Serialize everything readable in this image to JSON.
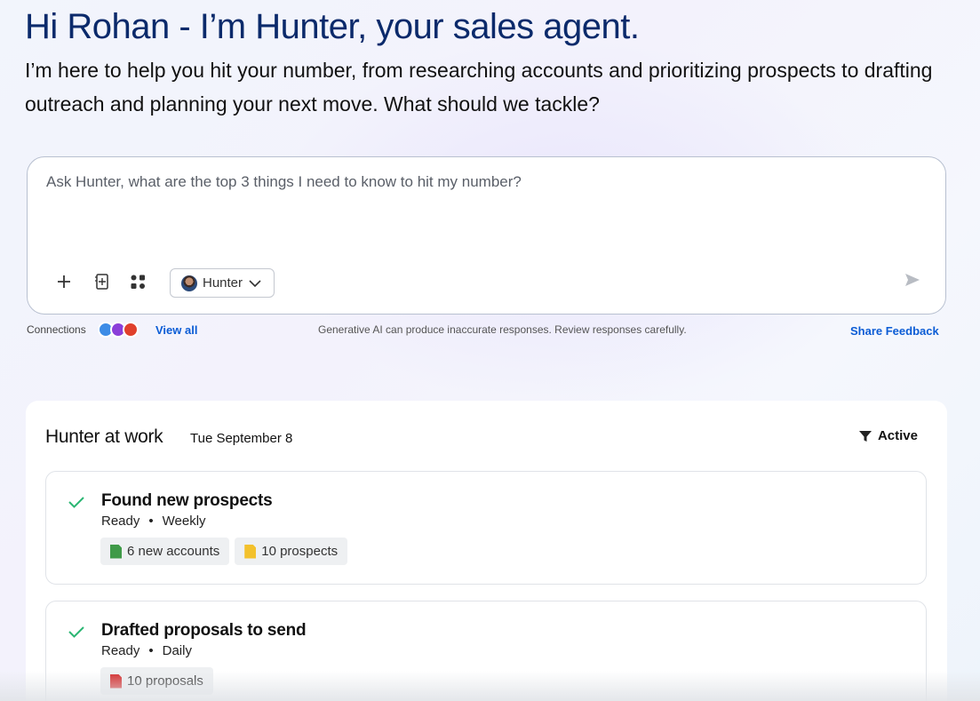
{
  "header": {
    "greeting": "Hi Rohan - I’m Hunter, your sales agent.",
    "intro": "I’m here to help you hit your number, from researching accounts and prioritizing prospects to drafting outreach and planning your next move. What should we tackle?"
  },
  "prompt": {
    "placeholder": "Ask Hunter, what are the top 3 things I need to know to hit my number?",
    "value": "",
    "agent_label": "Hunter",
    "tools": [
      "plus-icon",
      "document-add-icon",
      "apps-grid-icon"
    ],
    "send_icon": "send-icon"
  },
  "footer": {
    "connections_label": "Connections",
    "connection_icons": [
      {
        "name": "salesforce-cloud-icon",
        "color": "#3d8ce6"
      },
      {
        "name": "agentforce-icon",
        "color": "#8b3fd9"
      },
      {
        "name": "zendesk-icon",
        "color": "#e0402c"
      }
    ],
    "view_all": "View all",
    "disclaimer": "Generative AI can produce inaccurate responses. Review responses carefully.",
    "feedback": "Share Feedback"
  },
  "work": {
    "title": "Hunter at work",
    "date": "Tue September 8",
    "filter_label": "Active",
    "tasks": [
      {
        "title": "Found new prospects",
        "status": "Ready",
        "frequency": "Weekly",
        "chips": [
          {
            "label": "6 new accounts",
            "icon_color": "#3f9a48"
          },
          {
            "label": "10 prospects",
            "icon_color": "#f3c12c"
          }
        ]
      },
      {
        "title": "Drafted proposals to send",
        "status": "Ready",
        "frequency": "Daily",
        "chips": [
          {
            "label": "10 proposals",
            "icon_color": "#d42b2b"
          }
        ]
      }
    ]
  },
  "colors": {
    "headline": "#0b2a6b",
    "link": "#0b5cd5",
    "check": "#2bb673"
  }
}
